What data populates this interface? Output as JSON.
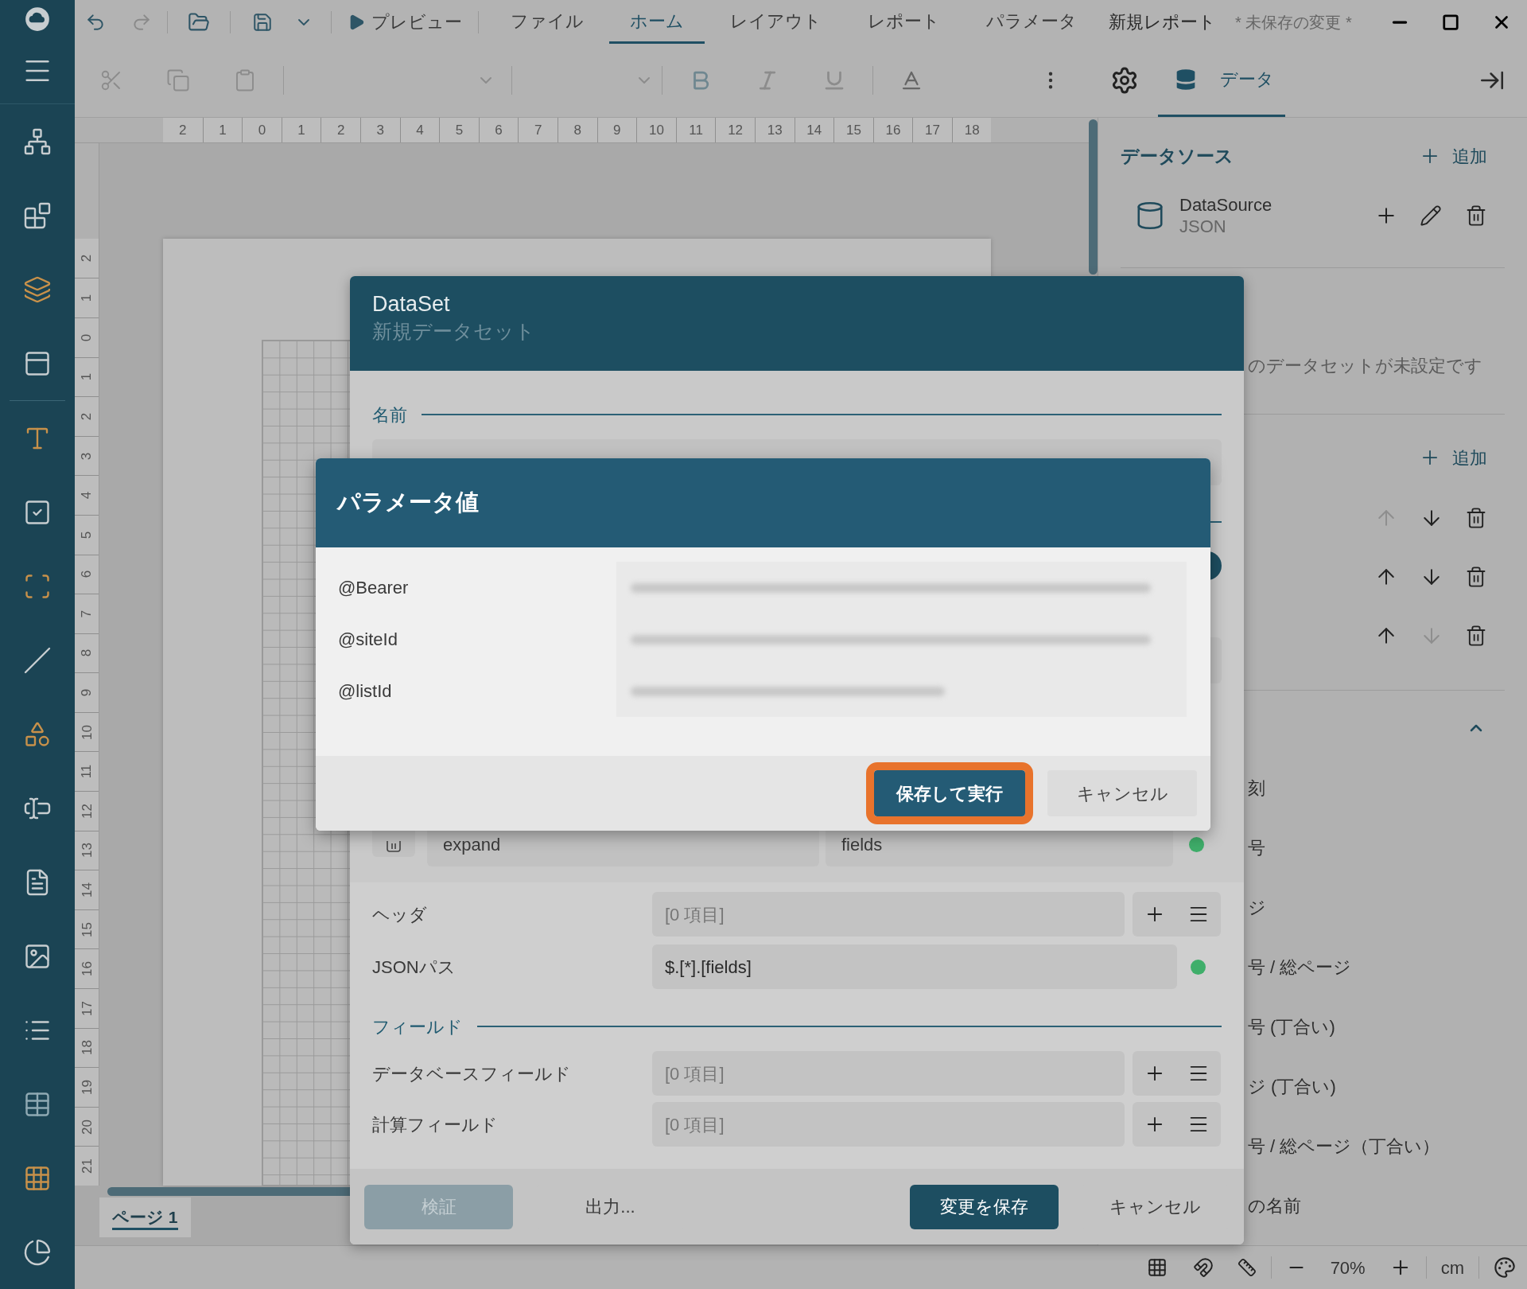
{
  "title_bar": {
    "preview_label": "プレビュー",
    "menu_tabs": [
      {
        "label": "ファイル",
        "selected": false
      },
      {
        "label": "ホーム",
        "selected": true
      },
      {
        "label": "レイアウト",
        "selected": false
      },
      {
        "label": "レポート",
        "selected": false
      },
      {
        "label": "パラメータ",
        "selected": false
      }
    ],
    "document_title": "新規レポート",
    "unsaved_label": "* 未保存の変更 *"
  },
  "toolbar": {
    "data_tab": {
      "label": "データ",
      "selected": true
    }
  },
  "ruler": {
    "horizontal": [
      "2",
      "1",
      "0",
      "1",
      "2",
      "3",
      "4",
      "5",
      "6",
      "7",
      "8",
      "9",
      "10",
      "11",
      "12",
      "13",
      "14",
      "15",
      "16",
      "17",
      "18"
    ],
    "vertical": [
      "2",
      "1",
      "0",
      "1",
      "2",
      "3",
      "4",
      "5",
      "6",
      "7",
      "8",
      "9",
      "10",
      "11",
      "12",
      "13",
      "14",
      "15",
      "16",
      "17",
      "18",
      "19",
      "20",
      "21"
    ]
  },
  "page_tabs": [
    {
      "label": "ページ 1",
      "selected": true
    }
  ],
  "data_panel": {
    "title": "データソース",
    "add_label": "追加",
    "sources": [
      {
        "name": "DataSource",
        "type": "JSON"
      }
    ],
    "dataset_message": "のデータセットが未設定です",
    "dataset_add_label": "追加",
    "order_rows": [
      {
        "up_disabled": true,
        "down_disabled": false
      },
      {
        "up_disabled": false,
        "down_disabled": false
      },
      {
        "up_disabled": false,
        "down_disabled": true
      }
    ],
    "fields_expanded": true,
    "fields": [
      "刻",
      "号",
      "ジ",
      "号 / 総ページ",
      "号 (丁合い)",
      "ジ (丁合い)",
      "号 / 総ページ（丁合い）",
      "の名前"
    ]
  },
  "status_bar": {
    "zoom": "70%",
    "unit": "cm"
  },
  "dataset_dialog": {
    "title": "DataSet",
    "subtitle": "新規データセット",
    "name_label": "名前",
    "query_param": {
      "name": "expand",
      "value": "fields",
      "valid": true
    },
    "headers": {
      "label": "ヘッダ",
      "value": "[0 項目]"
    },
    "json_path": {
      "label": "JSONパス",
      "value": "$.[*].[fields]",
      "valid": true
    },
    "fields_section": "フィールド",
    "field_rows": [
      {
        "label": "データベースフィールド",
        "value": "[0 項目]"
      },
      {
        "label": "計算フィールド",
        "value": "[0 項目]"
      }
    ],
    "buttons": [
      {
        "label": "検証",
        "kind": "secondary",
        "disabled": true
      },
      {
        "label": "出力...",
        "kind": "secondary",
        "disabled": false
      },
      {
        "label": "変更を保存",
        "kind": "primary",
        "disabled": false
      },
      {
        "label": "キャンセル",
        "kind": "secondary",
        "disabled": false
      }
    ]
  },
  "parameter_dialog": {
    "title": "パラメータ値",
    "parameters": [
      {
        "name": "@Bearer"
      },
      {
        "name": "@siteId"
      },
      {
        "name": "@listId"
      }
    ],
    "buttons": [
      {
        "label": "保存して実行",
        "kind": "primary",
        "highlighted": true
      },
      {
        "label": "キャンセル",
        "kind": "secondary",
        "highlighted": false
      }
    ]
  }
}
